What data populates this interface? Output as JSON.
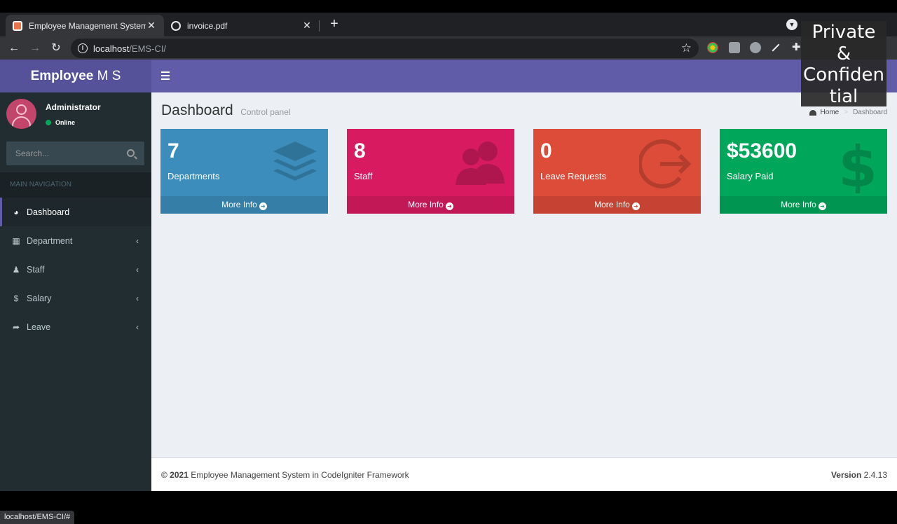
{
  "browser": {
    "tabs": [
      {
        "title": "Employee Management System",
        "active": true
      },
      {
        "title": "invoice.pdf",
        "active": false
      }
    ],
    "url_host": "localhost",
    "url_path": "/EMS-CI/",
    "status_url": "localhost/EMS-CI/#"
  },
  "watermark": {
    "lines": [
      "Private",
      "&",
      "Confiden",
      "tial"
    ]
  },
  "app": {
    "logo_bold": "Employee",
    "logo_rest": " M S"
  },
  "user": {
    "name": "Administrator",
    "status": "Online"
  },
  "search": {
    "placeholder": "Search..."
  },
  "sidebar": {
    "header": "MAIN NAVIGATION",
    "items": [
      {
        "label": "Dashboard",
        "icon": "dashboard-icon",
        "active": true
      },
      {
        "label": "Department",
        "icon": "grid-icon"
      },
      {
        "label": "Staff",
        "icon": "users-icon"
      },
      {
        "label": "Salary",
        "icon": "dollar-icon"
      },
      {
        "label": "Leave",
        "icon": "share-icon"
      }
    ]
  },
  "page": {
    "title": "Dashboard",
    "subtitle": "Control panel",
    "breadcrumb": [
      "Home",
      "Dashboard"
    ]
  },
  "cards": [
    {
      "value": "7",
      "label": "Departments",
      "link": "More Info",
      "color": "#3c8dbc",
      "icon": "layers-icon"
    },
    {
      "value": "8",
      "label": "Staff",
      "link": "More Info",
      "color": "#d81b60",
      "icon": "users-icon"
    },
    {
      "value": "0",
      "label": "Leave Requests",
      "link": "More Info",
      "color": "#dd4b39",
      "icon": "sign-out-icon"
    },
    {
      "value": "$53600",
      "label": "Salary Paid",
      "link": "More Info",
      "color": "#00a65a",
      "icon": "dollar-icon"
    }
  ],
  "footer": {
    "copyright_bold": "© 2021",
    "copyright_text": " Employee Management System in CodeIgniter Framework",
    "version_label": "Version",
    "version_value": " 2.4.13"
  }
}
